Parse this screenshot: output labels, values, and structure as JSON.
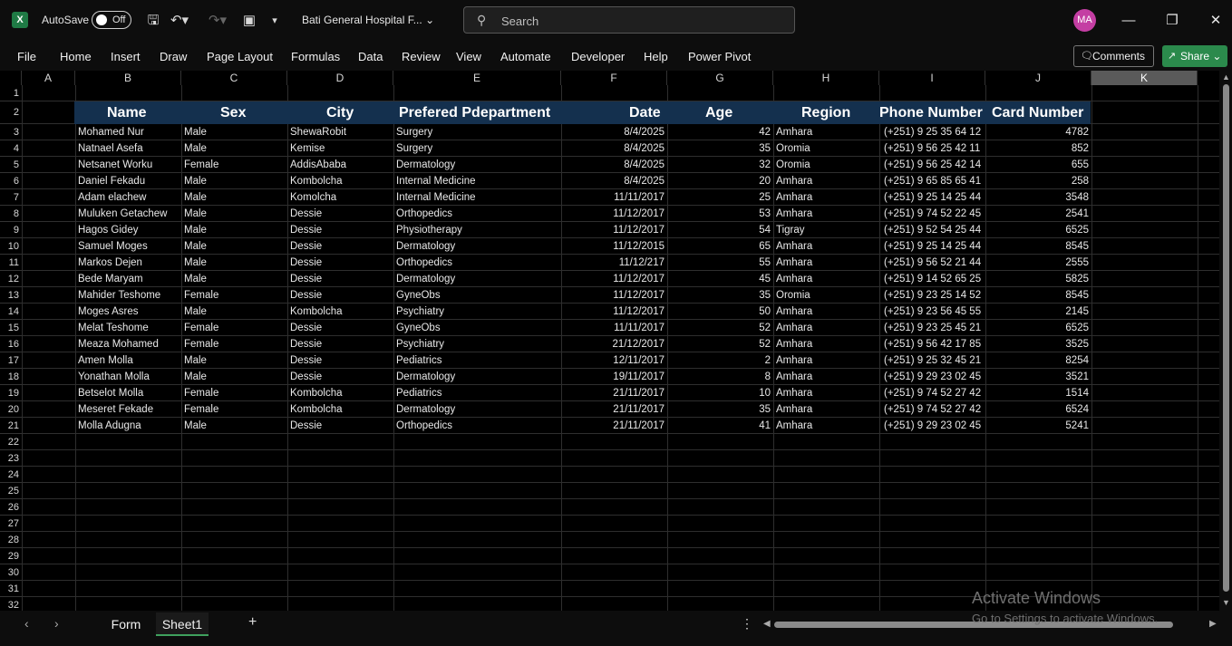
{
  "titlebar": {
    "autosave_label": "AutoSave",
    "autosave_state": "Off",
    "doc_title": "Bati General Hospital F...",
    "search_placeholder": "Search",
    "avatar_initials": "MA"
  },
  "ribbon": {
    "tabs": [
      "File",
      "Home",
      "Insert",
      "Draw",
      "Page Layout",
      "Formulas",
      "Data",
      "Review",
      "View",
      "Automate",
      "Developer",
      "Help",
      "Power Pivot"
    ],
    "comments_label": "Comments",
    "share_label": "Share"
  },
  "grid": {
    "columns": [
      "A",
      "B",
      "C",
      "D",
      "E",
      "F",
      "G",
      "H",
      "I",
      "J",
      "K"
    ],
    "selected_column": "K",
    "row_numbers": [
      "1",
      "2",
      "3",
      "4",
      "5",
      "6",
      "7",
      "8",
      "9",
      "10",
      "11",
      "12",
      "13",
      "14",
      "15",
      "16",
      "17",
      "18",
      "19",
      "20",
      "21",
      "22",
      "23",
      "24",
      "25",
      "26",
      "27",
      "28",
      "29",
      "30",
      "31",
      "32"
    ]
  },
  "table": {
    "headers": [
      "Name",
      "Sex",
      "City",
      "Prefered Pdepartment",
      "Date",
      "Age",
      "Region",
      "Phone Number",
      "Card Number"
    ],
    "rows": [
      [
        "Mohamed Nur",
        "Male",
        "ShewaRobit",
        "Surgery",
        "8/4/2025",
        "42",
        "Amhara",
        "(+251) 9 25 35 64 12",
        "4782"
      ],
      [
        "Natnael Asefa",
        "Male",
        "Kemise",
        "Surgery",
        "8/4/2025",
        "35",
        "Oromia",
        "(+251) 9 56 25 42 11",
        "852"
      ],
      [
        "Netsanet Worku",
        "Female",
        "AddisAbaba",
        "Dermatology",
        "8/4/2025",
        "32",
        "Oromia",
        "(+251) 9 56 25 42 14",
        "655"
      ],
      [
        "Daniel Fekadu",
        "Male",
        "Kombolcha",
        "Internal Medicine",
        "8/4/2025",
        "20",
        "Amhara",
        "(+251) 9 65 85 65 41",
        "258"
      ],
      [
        "Adam elachew",
        "Male",
        "Komolcha",
        "Internal Medicine",
        "11/11/2017",
        "25",
        "Amhara",
        "(+251) 9 25 14 25 44",
        "3548"
      ],
      [
        "Muluken Getachew",
        "Male",
        "Dessie",
        "Orthopedics",
        "11/12/2017",
        "53",
        "Amhara",
        "(+251) 9 74 52 22 45",
        "2541"
      ],
      [
        "Hagos Gidey",
        "Male",
        "Dessie",
        "Physiotherapy",
        "11/12/2017",
        "54",
        "Tigray",
        "(+251) 9 52 54 25 44",
        "6525"
      ],
      [
        "Samuel Moges",
        "Male",
        "Dessie",
        "Dermatology",
        "11/12/2015",
        "65",
        "Amhara",
        "(+251) 9 25 14 25 44",
        "8545"
      ],
      [
        "Markos Dejen",
        "Male",
        "Dessie",
        "Orthopedics",
        "11/12/217",
        "55",
        "Amhara",
        "(+251) 9 56 52 21 44",
        "2555"
      ],
      [
        "Bede Maryam",
        "Male",
        "Dessie",
        "Dermatology",
        "11/12/2017",
        "45",
        "Amhara",
        "(+251) 9 14 52 65 25",
        "5825"
      ],
      [
        "Mahider Teshome",
        "Female",
        "Dessie",
        "GyneObs",
        "11/12/2017",
        "35",
        "Oromia",
        "(+251) 9 23 25 14 52",
        "8545"
      ],
      [
        "Moges Asres",
        "Male",
        "Kombolcha",
        "Psychiatry",
        "11/12/2017",
        "50",
        "Amhara",
        "(+251) 9 23 56 45 55",
        "2145"
      ],
      [
        "Melat Teshome",
        "Female",
        "Dessie",
        "GyneObs",
        "11/11/2017",
        "52",
        "Amhara",
        "(+251) 9 23 25 45 21",
        "6525"
      ],
      [
        "Meaza Mohamed",
        "Female",
        "Dessie",
        "Psychiatry",
        "21/12/2017",
        "52",
        "Amhara",
        "(+251) 9 56 42 17 85",
        "3525"
      ],
      [
        "Amen Molla",
        "Male",
        "Dessie",
        "Pediatrics",
        "12/11/2017",
        "2",
        "Amhara",
        "(+251) 9 25 32 45 21",
        "8254"
      ],
      [
        "Yonathan Molla",
        "Male",
        "Dessie",
        "Dermatology",
        "19/11/2017",
        "8",
        "Amhara",
        "(+251) 9 29 23 02 45",
        "3521"
      ],
      [
        "Betselot Molla",
        "Female",
        "Kombolcha",
        "Pediatrics",
        "21/11/2017",
        "10",
        "Amhara",
        "(+251) 9 74 52 27 42",
        "1514"
      ],
      [
        "Meseret Fekade",
        "Female",
        "Kombolcha",
        "Dermatology",
        "21/11/2017",
        "35",
        "Amhara",
        "(+251) 9 74 52 27 42",
        "6524"
      ],
      [
        "Molla Adugna",
        "Male",
        "Dessie",
        "Orthopedics",
        "21/11/2017",
        "41",
        "Amhara",
        "(+251) 9 29 23 02 45",
        "5241"
      ]
    ]
  },
  "sheets": {
    "tabs": [
      "Form",
      "Sheet1"
    ],
    "active": "Sheet1"
  },
  "watermark": {
    "line1": "Activate Windows",
    "line2": "Go to Settings to activate Windows."
  },
  "colors": {
    "header_fill": "#14304e",
    "share_green": "#2b8a4c",
    "avatar": "#c43ea3"
  }
}
